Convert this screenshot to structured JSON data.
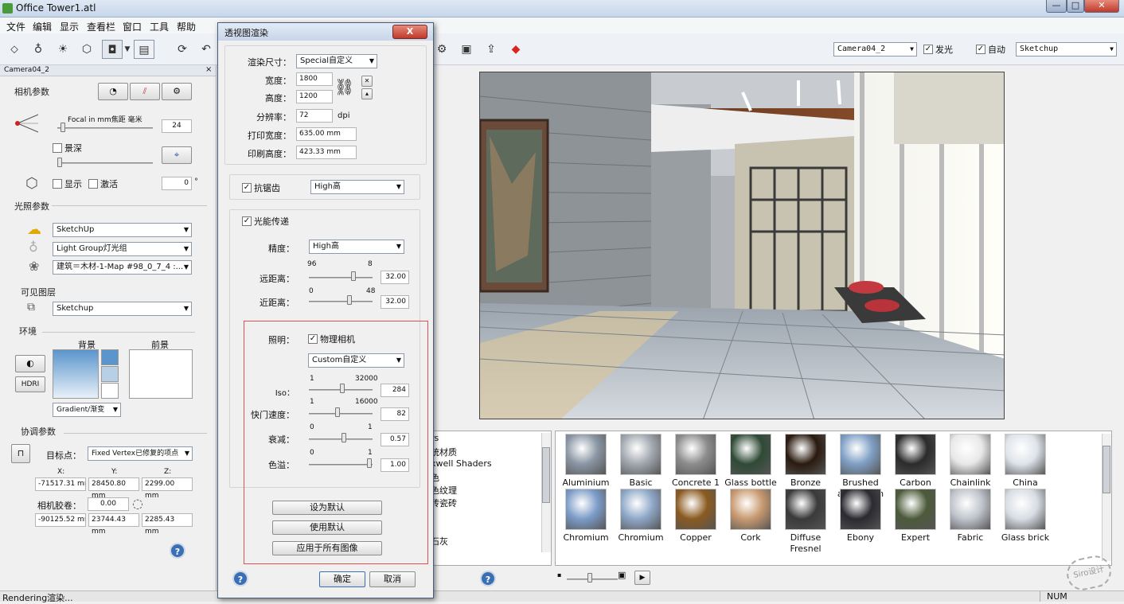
{
  "window": {
    "title": "Office Tower1.atl"
  },
  "menu": [
    "文件",
    "编辑",
    "显示",
    "查看栏",
    "窗口",
    "工具",
    "帮助"
  ],
  "toolbar": {
    "camera_select": "Camera04_2",
    "glow_label": "发光",
    "auto_label": "自动",
    "style_select": "Sketchup"
  },
  "left": {
    "header": "Camera04_2",
    "camera_section": "相机参数",
    "focal_label": "Focal in mm焦距 毫米",
    "focal_value": "24",
    "dof_label": "景深",
    "show_label": "显示",
    "activate_label": "激活",
    "activate_value": "0",
    "degree_symbol": "°",
    "light_section": "光照参数",
    "sky_select": "SketchUp",
    "light_group_select": "Light Group灯光组",
    "material_select": "建筑＝木材-1-Map #98_0_7_4 :...",
    "layer_section": "可见图层",
    "layer_select": "Sketchup",
    "env_section": "环境",
    "bg_label": "背景",
    "fg_label": "前景",
    "hdri_label": "HDRI",
    "gradient_select": "Gradient/渐变",
    "coord_section": "协调参数",
    "target_label": "目标点：",
    "target_select": "Fixed Vertex已修复的项点",
    "x_label": "X:",
    "y_label": "Y:",
    "z_label": "Z:",
    "x1": "-71517.31 mm",
    "y1": "28450.80 mm",
    "z1": "2299.00 mm",
    "roll_label": "相机胶卷：",
    "roll_value": "0.00",
    "x2": "-90125.52 mm",
    "y2": "23744.43 mm",
    "z2": "2285.43 mm",
    "help": "?"
  },
  "dialog": {
    "title": "透视图渲染",
    "close": "X",
    "size_label": "渲染尺寸：",
    "size_select": "Special自定义",
    "width_label": "宽度：",
    "width_value": "1800",
    "height_label": "高度：",
    "height_value": "1200",
    "res_label": "分辨率：",
    "res_value": "72",
    "res_unit": "dpi",
    "print_w_label": "打印宽度：",
    "print_w_value": "635.00 mm",
    "print_h_label": "印刷高度：",
    "print_h_value": "423.33 mm",
    "aa_label": "抗锯齿",
    "aa_select": "High高",
    "radiosity_label": "光能传递",
    "precision_label": "精度：",
    "precision_select": "High高",
    "far_label": "远距离：",
    "far_min": "96",
    "far_max": "8",
    "far_value": "32.00",
    "near_label": "近距离：",
    "near_min": "0",
    "near_max": "48",
    "near_value": "32.00",
    "lighting_label": "照明：",
    "physcam_label": "物理相机",
    "custom_select": "Custom自定义",
    "iso_label": "Iso：",
    "iso_min": "1",
    "iso_max": "32000",
    "iso_value": "284",
    "shutter_label": "快门速度：",
    "shutter_min": "1",
    "shutter_max": "16000",
    "shutter_value": "82",
    "decay_label": "衰减：",
    "decay_min": "0",
    "decay_max": "1",
    "decay_value": "0.57",
    "overflow_label": "色溢：",
    "overflow_min": "0",
    "overflow_max": "1",
    "overflow_value": "1.00",
    "set_default": "设为默认",
    "use_default": "使用默认",
    "apply_all": "应用于所有图像",
    "ok": "确定",
    "cancel": "取消",
    "help": "?"
  },
  "matlist": [
    "rs",
    "统材质",
    "xwell Shaders",
    "色",
    "色纹理",
    "砖瓷砖",
    "",
    "",
    "石灰",
    ""
  ],
  "materials_row1": [
    "Aluminium",
    "Basic",
    "Concrete 1",
    "Glass bottle",
    "Bronze",
    "Brushed aluminium",
    "Carbon",
    "Chainlink fencing",
    "China"
  ],
  "materials_row2": [
    "Chromium",
    "Chromium",
    "Copper",
    "Cork",
    "Diffuse Fresnel",
    "Ebony",
    "Expert",
    "Fabric",
    "Glass brick"
  ],
  "status": {
    "left": "Rendering渲染...",
    "num": "NUM"
  },
  "watermark": "Siro设计"
}
